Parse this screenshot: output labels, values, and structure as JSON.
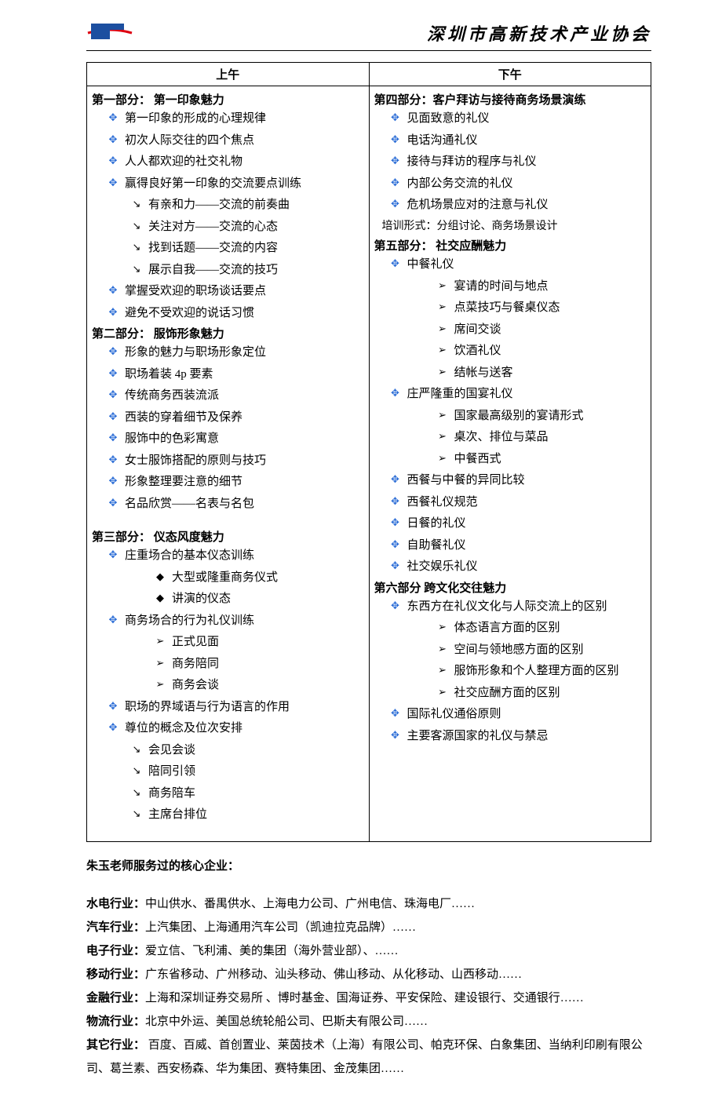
{
  "header": {
    "org": "深圳市高新技术产业协会"
  },
  "table": {
    "col1": "上午",
    "col2": "下午"
  },
  "morning": {
    "p1": {
      "title": "第一部分：  第一印象魅力",
      "i1": "第一印象的形成的心理规律",
      "i2": "初次人际交往的四个焦点",
      "i3": "人人都欢迎的社交礼物",
      "i4": "赢得良好第一印象的交流要点训练",
      "s1": "有亲和力――交流的前奏曲",
      "s2": "关注对方――交流的心态",
      "s3": "找到话题――交流的内容",
      "s4": "展示自我――交流的技巧",
      "i5": "掌握受欢迎的职场谈话要点",
      "i6": "避免不受欢迎的说话习惯"
    },
    "p2": {
      "title": "第二部分：  服饰形象魅力",
      "i1": "形象的魅力与职场形象定位",
      "i2": "职场着装 4p 要素",
      "i3": "传统商务西装流派",
      "i4": "西装的穿着细节及保养",
      "i5": "服饰中的色彩寓意",
      "i6": "女士服饰搭配的原则与技巧",
      "i7": "形象整理要注意的细节",
      "i8": "名品欣赏――名表与名包"
    },
    "p3": {
      "title": "第三部分：  仪态风度魅力",
      "i1": "庄重场合的基本仪态训练",
      "d1": "大型或隆重商务仪式",
      "d2": "讲演的仪态",
      "i2": "商务场合的行为礼仪训练",
      "c1": "正式见面",
      "c2": "商务陪同",
      "c3": "商务会谈",
      "i3": "职场的界域语与行为语言的作用",
      "i4": "尊位的概念及位次安排",
      "s1": "会见会谈",
      "s2": "陪同引领",
      "s3": "商务陪车",
      "s4": "主席台排位"
    }
  },
  "afternoon": {
    "p4": {
      "title": "第四部分：客户拜访与接待商务场景演练",
      "i1": "见面致意的礼仪",
      "i2": "电话沟通礼仪",
      "i3": "接待与拜访的程序与礼仪",
      "i4": "内部公务交流的礼仪",
      "i5": "危机场景应对的注意与礼仪",
      "note": "培训形式：分组讨论、商务场景设计"
    },
    "p5": {
      "title": "第五部分：  社交应酬魅力",
      "i1": "中餐礼仪",
      "c1": "宴请的时间与地点",
      "c2": "点菜技巧与餐桌仪态",
      "c3": "席间交谈",
      "c4": "饮酒礼仪",
      "c5": "结帐与送客",
      "i2": "庄严隆重的国宴礼仪",
      "c6": "国家最高级别的宴请形式",
      "c7": "桌次、排位与菜品",
      "c8": "中餐西式",
      "i3": "西餐与中餐的异同比较",
      "i4": "西餐礼仪规范",
      "i5": "日餐的礼仪",
      "i6": "自助餐礼仪",
      "i7": "社交娱乐礼仪"
    },
    "p6": {
      "title": "第六部分  跨文化交往魅力",
      "i1": "东西方在礼仪文化与人际交流上的区别",
      "c1": "体态语言方面的区别",
      "c2": "空间与领地感方面的区别",
      "c3": "服饰形象和个人整理方面的区别",
      "c4": "社交应酬方面的区别",
      "i2": "国际礼仪通俗原则",
      "i3": "主要客源国家的礼仪与禁忌"
    }
  },
  "clients": {
    "heading": "朱玉老师服务过的核心企业：",
    "ind1_label": "水电行业：",
    "ind1_text": "中山供水、番禺供水、上海电力公司、广州电信、珠海电厂……",
    "ind2_label": "汽车行业：",
    "ind2_text": "上汽集团、上海通用汽车公司（凯迪拉克品牌）……",
    "ind3_label": "电子行业：",
    "ind3_text": "爱立信、飞利浦、美的集团（海外营业部）、……",
    "ind4_label": "移动行业：",
    "ind4_text": "广东省移动、广州移动、汕头移动、佛山移动、从化移动、山西移动……",
    "ind5_label": "金融行业：",
    "ind5_text": "上海和深圳证券交易所 、博时基金、国海证券、平安保险、建设银行、交通银行……",
    "ind6_label": "物流行业：",
    "ind6_text": "北京中外运、美国总统轮船公司、巴斯夫有限公司……",
    "ind7_label": "其它行业：",
    "ind7_text": " 百度、百威、首创置业、莱茵技术（上海）有限公司、帕克环保、白象集团、当纳利印刷有限公司、葛兰素、西安杨森、华为集团、赛特集团、金茂集团……"
  }
}
